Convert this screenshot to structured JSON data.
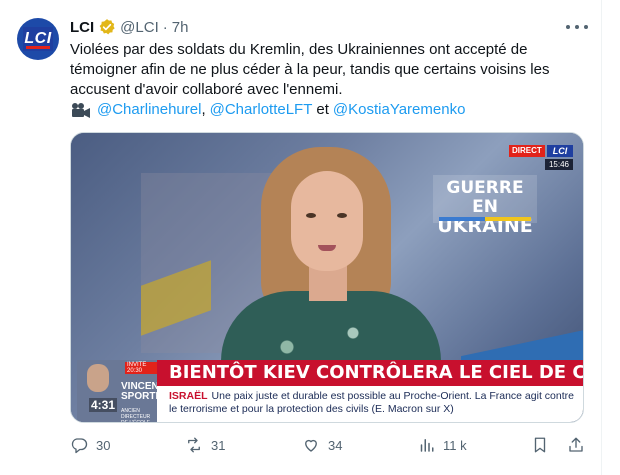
{
  "tweet": {
    "author_name": "LCI",
    "author_handle": "@LCI",
    "separator": "·",
    "time": "7h",
    "avatar_text": "LCI",
    "text": "Violées par des soldats du Kremlin, des Ukrainiennes ont accepté de témoigner afin de ne plus céder à la peur, tandis que certains voisins les accusent d'avoir collaboré avec l'ennemi.",
    "mentions": [
      "@Charlinehurel",
      "@CharlotteLFT",
      "@KostiaYaremenko"
    ],
    "mention_separator": ",",
    "mention_joiner": "et",
    "camera_icon": "movie-camera-icon",
    "verified_icon": "verified-gold-badge-icon"
  },
  "media": {
    "direct_label": "DIRECT",
    "channel_label": "LCI",
    "clock": "15:46",
    "program_title_line1": "GUERRE EN",
    "program_title_line2": "UKRAINE",
    "inset_live": "INVITE 20:30",
    "inset_name_line1": "VINCENT",
    "inset_name_line2": "SPORTES",
    "inset_timer": "4:31",
    "inset_caption": "ANCIEN DIRECTEUR DE L'ÉCOLE DE GUERRE",
    "headline": "BIENTÔT KIEV CONTRÔLERA LE CIEL DE CRIMÉE ?",
    "ticker_keyword": "ISRAËL",
    "ticker_text": "Une paix juste et durable est possible au Proche-Orient. La France agit contre le terrorisme et pour la protection des civils (E. Macron sur X)"
  },
  "actions": {
    "replies": "30",
    "reposts": "31",
    "likes": "34",
    "views": "11 k"
  },
  "colors": {
    "link": "#1d9bf0",
    "muted": "#536471",
    "lci_blue": "#1f3fa0",
    "lci_red": "#e2231a",
    "banner_red": "#c8102e"
  }
}
